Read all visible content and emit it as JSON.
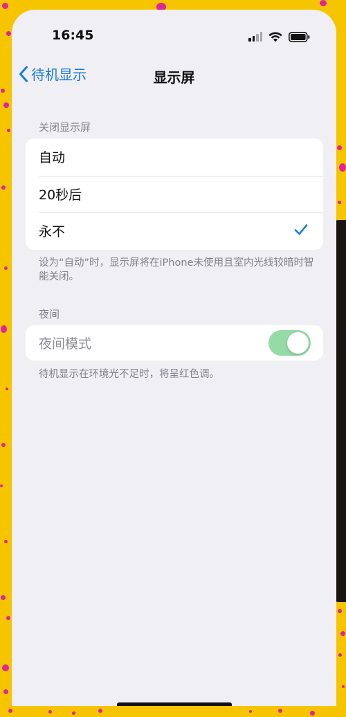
{
  "status_bar": {
    "time": "16:45",
    "icons": [
      "cellular-signal-icon",
      "wifi-icon",
      "battery-icon"
    ]
  },
  "nav": {
    "back_label": "待机显示",
    "title": "显示屏",
    "back_icon": "chevron-left-icon"
  },
  "sections": {
    "auto_off": {
      "header": "关闭显示屏",
      "options": [
        {
          "label": "自动",
          "selected": false
        },
        {
          "label": "20秒后",
          "selected": false
        },
        {
          "label": "永不",
          "selected": true
        }
      ],
      "footer": "设为“自动”时，显示屏将在iPhone未使用且室内光线较暗时智能关闭。"
    },
    "night": {
      "header": "夜间",
      "row_label": "夜间模式",
      "toggle_on": true,
      "footer": "待机显示在环境光不足时，将呈红色调。"
    }
  },
  "colors": {
    "accent": "#1a7ad8",
    "toggle_on": "#94dba6",
    "background": "#efeff4",
    "frame": "#f7c500",
    "dots": "#e0249b"
  }
}
